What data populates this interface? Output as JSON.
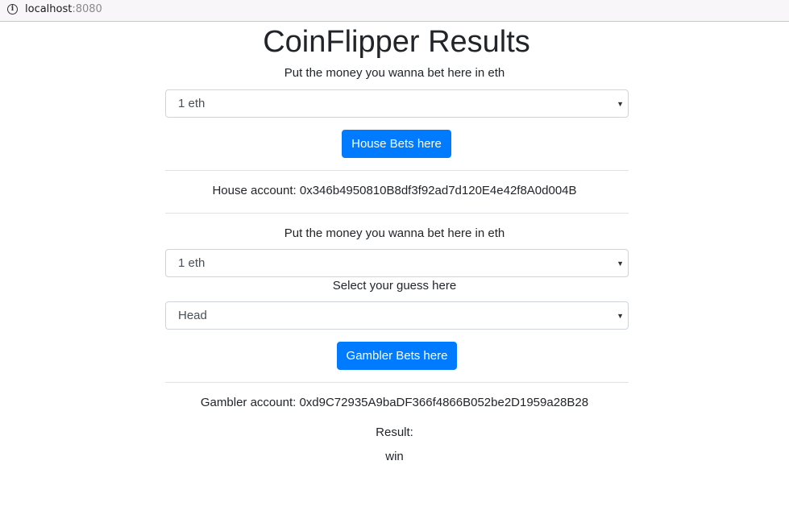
{
  "browser": {
    "url_host": "localhost",
    "url_port": ":8080"
  },
  "page": {
    "title": "CoinFlipper Results"
  },
  "house": {
    "bet_prompt": "Put the money you wanna bet here in eth",
    "bet_selected": "1 eth",
    "button_label": "House Bets here",
    "account_text": "House account: 0x346b4950810B8df3f92ad7d120E4e42f8A0d004B"
  },
  "gambler": {
    "bet_prompt": "Put the money you wanna bet here in eth",
    "bet_selected": "1 eth",
    "guess_prompt": "Select your guess here",
    "guess_selected": "Head",
    "button_label": "Gambler Bets here",
    "account_text": "Gambler account: 0xd9C72935A9baDF366f4866B052be2D1959a28B28"
  },
  "result": {
    "label": "Result:",
    "value": "win"
  },
  "colors": {
    "primary": "#007bff",
    "text": "#212529"
  }
}
